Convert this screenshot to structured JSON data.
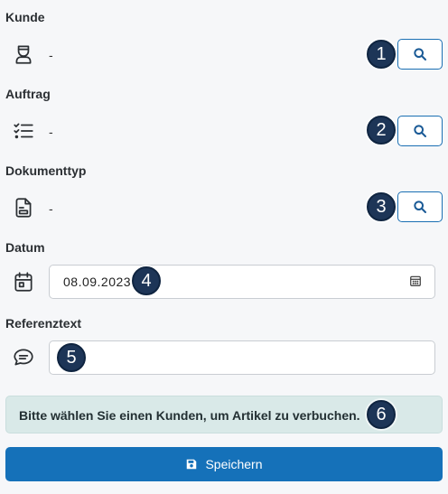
{
  "customer": {
    "label": "Kunde",
    "value": "-",
    "icon": "user-icon",
    "badge": "1"
  },
  "order": {
    "label": "Auftrag",
    "value": "-",
    "icon": "checklist-icon",
    "badge": "2"
  },
  "document_type": {
    "label": "Dokumenttyp",
    "value": "-",
    "icon": "document-icon",
    "badge": "3"
  },
  "date": {
    "label": "Datum",
    "value": "08.09.2023",
    "icon": "calendar-icon",
    "badge": "4"
  },
  "reference": {
    "label": "Referenztext",
    "value": "",
    "icon": "chat-icon",
    "badge": "5"
  },
  "alert": {
    "text": "Bitte wählen Sie einen Kunden, um Artikel zu verbuchen.",
    "badge": "6"
  },
  "save_button": {
    "label": "Speichern",
    "icon": "save-icon"
  },
  "colors": {
    "accent": "#1571b9",
    "badge": "#1d3557",
    "alert_bg": "#d9e9e8"
  }
}
